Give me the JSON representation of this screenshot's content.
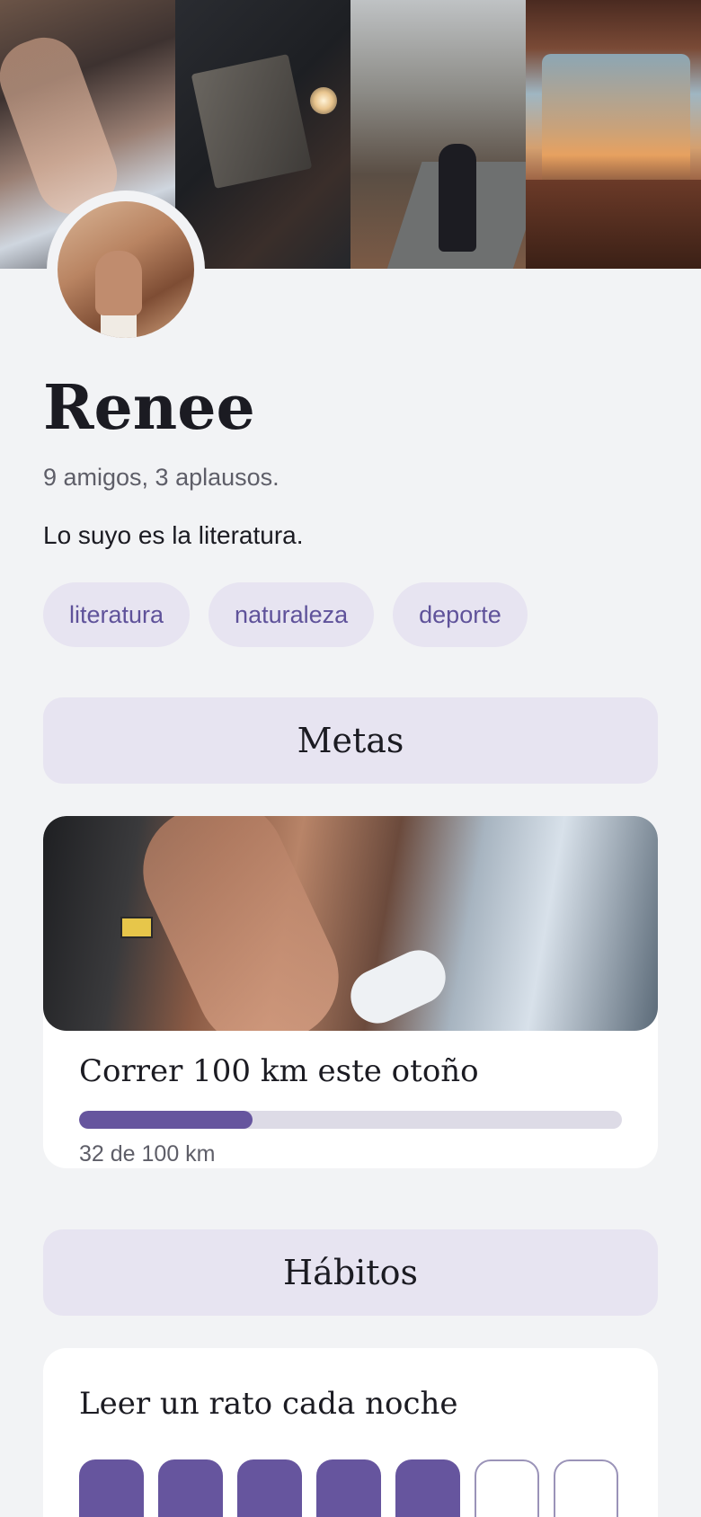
{
  "profile": {
    "name": "Renee",
    "stats": "9 amigos, 3 aplausos.",
    "bio": "Lo suyo es la literatura.",
    "tags": [
      "literatura",
      "naturaleza",
      "deporte"
    ]
  },
  "sections": {
    "metas": "Metas",
    "habitos": "Hábitos"
  },
  "goal": {
    "title": "Correr 100 km este otoño",
    "progress_text": "32 de 100 km",
    "progress_fraction": 0.32
  },
  "habit": {
    "title": "Leer un rato cada noche",
    "days": [
      true,
      true,
      true,
      true,
      true,
      false,
      false
    ]
  },
  "colors": {
    "accent": "#66559e",
    "tag_bg": "#e7e4f1",
    "background": "#f2f3f5"
  }
}
